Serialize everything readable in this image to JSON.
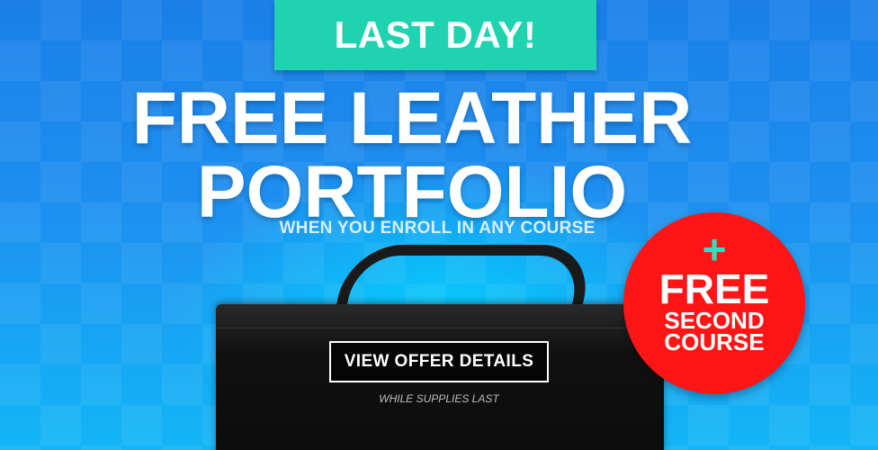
{
  "top_ribbon": {
    "label": "LAST DAY!"
  },
  "headline": {
    "line1": "FREE LEATHER",
    "line2": "PORTFOLIO"
  },
  "subheadline": "WHEN YOU ENROLL IN ANY COURSE",
  "cta": {
    "label": "VIEW OFFER DETAILS"
  },
  "disclaimer": "WHILE SUPPLIES LAST",
  "badge": {
    "plus": "+",
    "line1": "FREE",
    "line2": "SECOND",
    "line3": "COURSE"
  },
  "colors": {
    "ribbon": "#1fd3b0",
    "badge": "#ff1515",
    "plus": "#2fe0c0",
    "background": "#1d8ff0"
  },
  "image": {
    "product": "black-leather-portfolio"
  }
}
